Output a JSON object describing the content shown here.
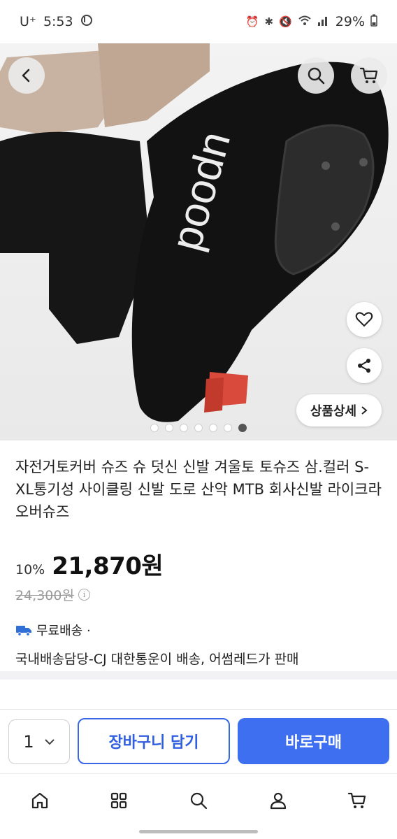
{
  "status_bar": {
    "carrier": "U⁺",
    "time": "5:53",
    "battery": "29%"
  },
  "hero": {
    "detail_button_label": "상품상세",
    "carousel_count": 7,
    "carousel_active_index": 6,
    "product_logo_text": "poodn"
  },
  "product": {
    "title": "자전거토커버 슈즈 슈 덧신 신발 겨울토 토슈즈 삼.컬러 S-XL통기성 사이클링 신발 도로 산악 MTB 회사신발 라이크라 오버슈즈",
    "discount": "10%",
    "price": "21,870원",
    "original_price": "24,300원"
  },
  "shipping": {
    "free_shipping": "무료배송 ·",
    "seller_info": "국내배송담당-CJ 대한통운이 배송, 어썸레드가 판매"
  },
  "actions": {
    "quantity": "1",
    "add_to_cart": "장바구니 담기",
    "buy_now": "바로구매"
  },
  "colors": {
    "accent": "#3d6ff0",
    "accent_outline": "#3867e8"
  },
  "icons": {
    "back": "back-arrow-icon",
    "search": "search-icon",
    "cart": "cart-icon",
    "like": "heart-icon",
    "share": "share-icon",
    "info": "info-icon",
    "truck": "truck-icon",
    "nav": [
      "home-icon",
      "category-grid-icon",
      "search-icon",
      "profile-icon",
      "cart-icon"
    ]
  }
}
